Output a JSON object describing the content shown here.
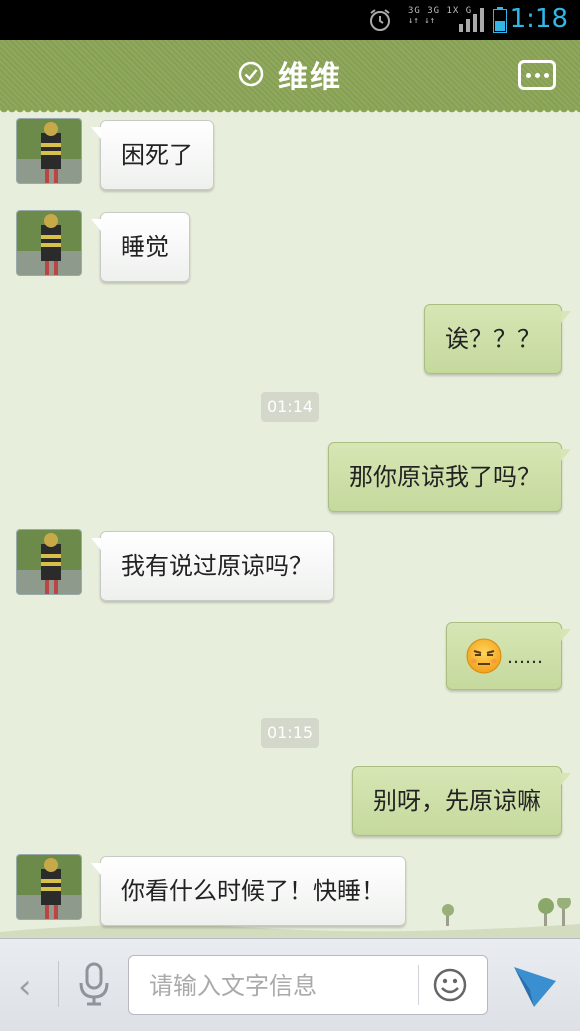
{
  "status_bar": {
    "time": "1:18",
    "network_row1": "3G 3G 1X  G",
    "network_row2": "↓↑ ↓↑",
    "icons": [
      "alarm-icon",
      "signal-icon",
      "battery-icon"
    ]
  },
  "header": {
    "title": "维维",
    "online_icon": "check-circle-icon",
    "menu_icon": "more-dots-icon"
  },
  "messages": [
    {
      "side": "left",
      "text": "困死了"
    },
    {
      "side": "left",
      "text": "睡觉"
    },
    {
      "side": "right",
      "text": "诶？？？"
    },
    {
      "type": "timestamp",
      "text": "01:14"
    },
    {
      "side": "right",
      "text": "那你原谅我了吗？"
    },
    {
      "side": "left",
      "text": "我有说过原谅吗？"
    },
    {
      "side": "right",
      "emoji": "annoyed-face-emoji",
      "text": "……"
    },
    {
      "type": "timestamp",
      "text": "01:15"
    },
    {
      "side": "right",
      "text": "别呀，先原谅嘛"
    },
    {
      "side": "left",
      "text": "你看什么时候了！快睡！"
    }
  ],
  "input_bar": {
    "back_icon": "chevron-left-icon",
    "mic_icon": "microphone-icon",
    "placeholder": "请输入文字信息",
    "emoji_icon": "smiley-icon",
    "send_icon": "send-arrow-icon"
  },
  "colors": {
    "header": "#8aa456",
    "chat_bg": "#e8eedc",
    "bubble_right": "#cfe1a9",
    "bubble_left": "#ffffff",
    "status_time": "#33b5e5"
  }
}
